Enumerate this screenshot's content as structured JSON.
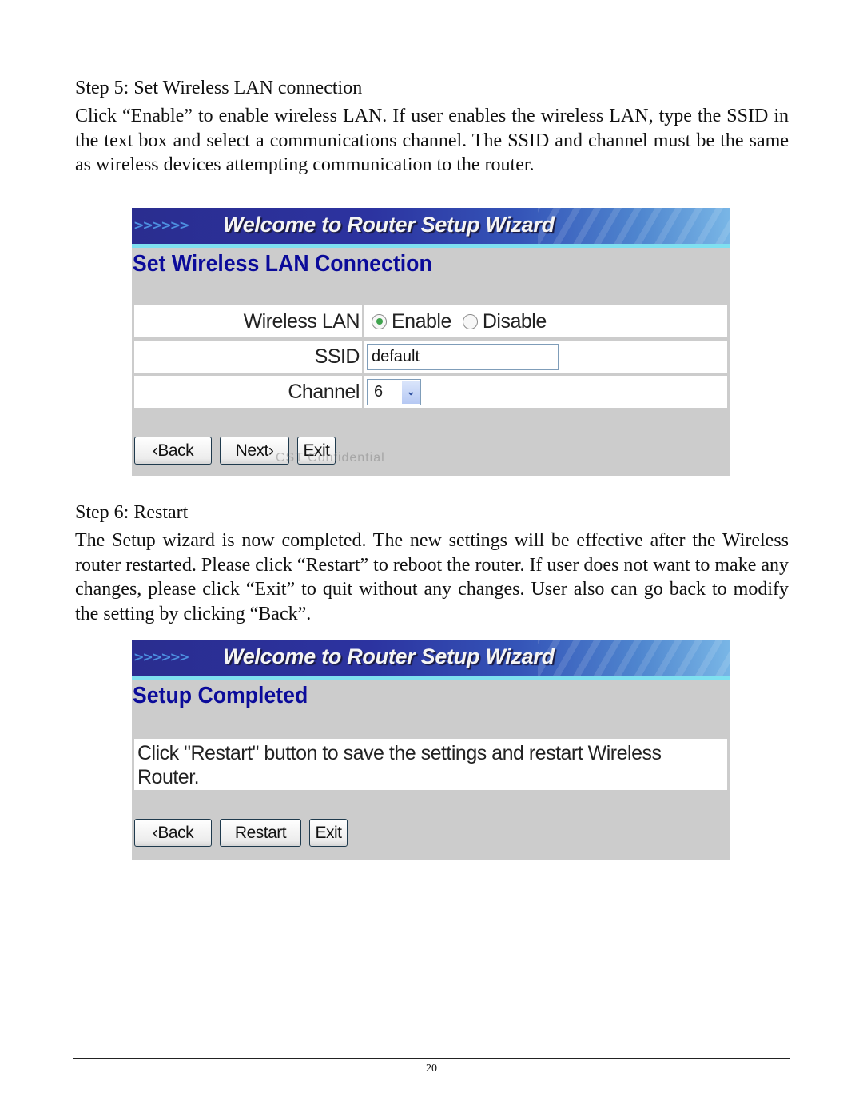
{
  "step5": {
    "heading": "Step 5: Set Wireless LAN connection",
    "body": "Click “Enable” to enable wireless LAN. If user enables the wireless LAN, type the SSID in the text box and select a communications channel. The SSID and channel must be the same as wireless devices attempting communication to the router."
  },
  "screenshot1": {
    "banner_arrows": ">>>>>>",
    "banner_title": "Welcome to Router Setup Wizard",
    "section_title": "Set Wireless LAN Connection",
    "fields": {
      "wireless_lan": {
        "label": "Wireless LAN",
        "options": [
          {
            "label": "Enable",
            "checked": true
          },
          {
            "label": "Disable",
            "checked": false
          }
        ]
      },
      "ssid": {
        "label": "SSID",
        "value": "default"
      },
      "channel": {
        "label": "Channel",
        "value": "6"
      }
    },
    "buttons": {
      "back": "‹Back",
      "next": "Next›",
      "exit": "Exit"
    },
    "watermark": "CST Confidential"
  },
  "step6": {
    "heading": "Step 6: Restart",
    "body": "The Setup wizard is now completed. The new settings will be effective after the Wireless router restarted. Please click “Restart” to reboot the router. If user does not want to make any changes, please click “Exit” to quit without any changes. User also can go back to modify the setting by clicking “Back”."
  },
  "screenshot2": {
    "banner_arrows": ">>>>>>",
    "banner_title": "Welcome to Router Setup Wizard",
    "section_title": "Setup Completed",
    "message": "Click \"Restart\" button to save the settings and restart Wireless Router.",
    "buttons": {
      "back": "‹Back",
      "restart": "Restart",
      "exit": "Exit"
    }
  },
  "footer": {
    "page_number": "20"
  }
}
